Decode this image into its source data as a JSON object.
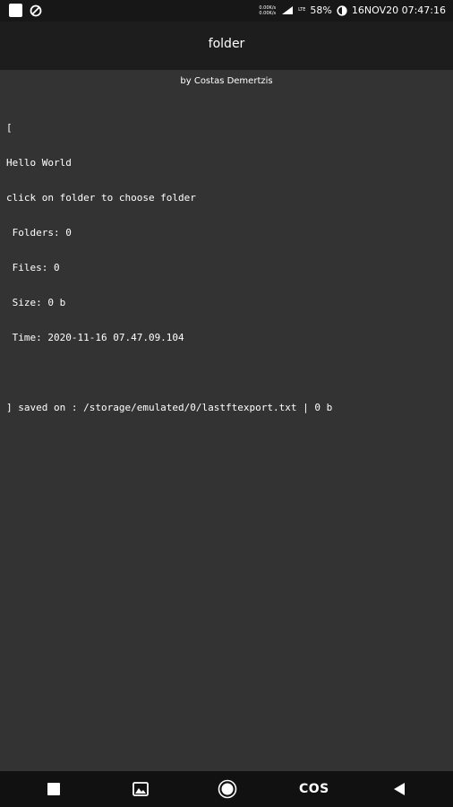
{
  "status_bar": {
    "net_speed_up": "0.00K/s",
    "net_speed_down": "0.00K/s",
    "network_type": "LTE",
    "battery": "58%",
    "datetime": "16NOV20 07:47:16"
  },
  "app_bar": {
    "title": "folder"
  },
  "author": "by Costas Demertzis",
  "console": {
    "lines": [
      "[",
      "Hello World",
      "click on folder to choose folder",
      " Folders: 0",
      " Files: 0",
      " Size: 0 b",
      " Time: 2020-11-16 07.47.09.104"
    ],
    "saved_line": "] saved on : /storage/emulated/0/lastftexport.txt | 0 b"
  },
  "nav_bar": {
    "cos_label": "COS"
  },
  "icons": {
    "status_left": [
      "square-icon",
      "sync-icon"
    ],
    "status_right": [
      "signal-icon",
      "battery-icon"
    ],
    "nav": [
      "recents-icon",
      "gallery-icon",
      "home-icon",
      "back-icon"
    ]
  },
  "colors": {
    "background": "#333333",
    "app_bar": "#1d1d1d",
    "status_bar": "#171717",
    "nav_bar": "#111111",
    "text": "#ffffff"
  }
}
